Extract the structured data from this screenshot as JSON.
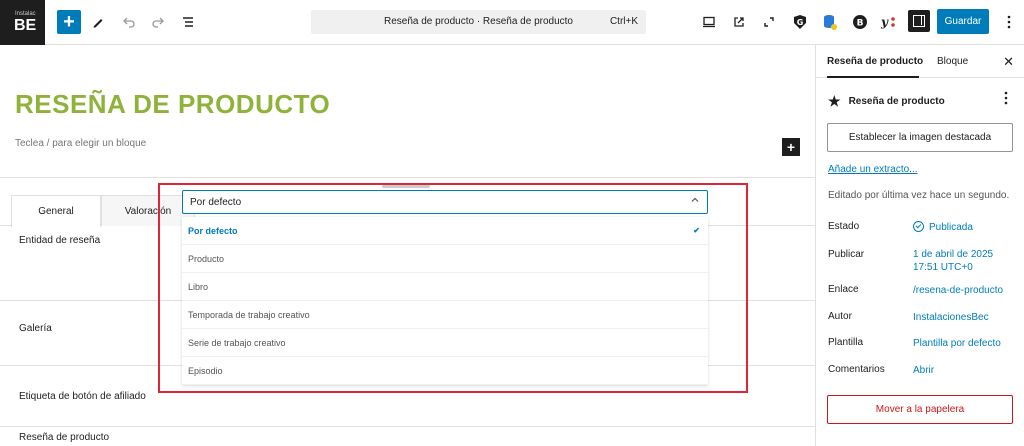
{
  "topbar": {
    "logo_small": "Instalac",
    "logo_text": "BE",
    "document_title": "Reseña de producto · Reseña de producto",
    "shortcut": "Ctrl+K",
    "save_label": "Guardar",
    "icons": [
      "plus-icon",
      "pencil-icon",
      "undo-icon",
      "redo-icon",
      "list-view-icon",
      "desktop-icon",
      "external-link-icon",
      "fullscreen-icon",
      "g-plugin-icon",
      "database-icon",
      "b-plugin-icon",
      "yoast-icon",
      "sidebar-toggle-icon",
      "kebab-icon"
    ]
  },
  "editor": {
    "post_title": "RESEÑA DE PRODUCTO",
    "block_hint": "Teclea / para elegir un bloque",
    "tabs": [
      {
        "label": "General"
      },
      {
        "label": "Valoración"
      }
    ],
    "rows": {
      "entidad": "Entidad de reseña",
      "galeria": "Galería",
      "etiqueta": "Etiqueta de botón de afiliado",
      "footer": "Reseña de producto"
    },
    "select": {
      "value": "Por defecto",
      "options": [
        {
          "label": "Por defecto",
          "selected": true
        },
        {
          "label": "Producto",
          "selected": false
        },
        {
          "label": "Libro",
          "selected": false
        },
        {
          "label": "Temporada de trabajo creativo",
          "selected": false
        },
        {
          "label": "Serie de trabajo creativo",
          "selected": false
        },
        {
          "label": "Episodio",
          "selected": false
        }
      ]
    },
    "highlight_color": "#e0253a",
    "title_color": "#8fb33a"
  },
  "sidebar": {
    "tab_post": "Reseña de producto",
    "tab_block": "Bloque",
    "post_type": "Reseña de producto",
    "featured_image": "Establecer la imagen destacada",
    "excerpt_link": "Añade un extracto...",
    "last_edited": "Editado por última vez hace un segundo.",
    "fields": [
      {
        "label": "Estado",
        "value": "Publicada"
      },
      {
        "label": "Publicar",
        "value": "1 de abril de 2025",
        "value2": "17:51 UTC+0"
      },
      {
        "label": "Enlace",
        "value": "/resena-de-producto"
      },
      {
        "label": "Autor",
        "value": "InstalacionesBec"
      },
      {
        "label": "Plantilla",
        "value": "Plantilla por defecto"
      },
      {
        "label": "Comentarios",
        "value": "Abrir"
      }
    ],
    "trash": "Mover a la papelera"
  },
  "colors": {
    "accent": "#007cba",
    "danger": "#cc1818"
  }
}
